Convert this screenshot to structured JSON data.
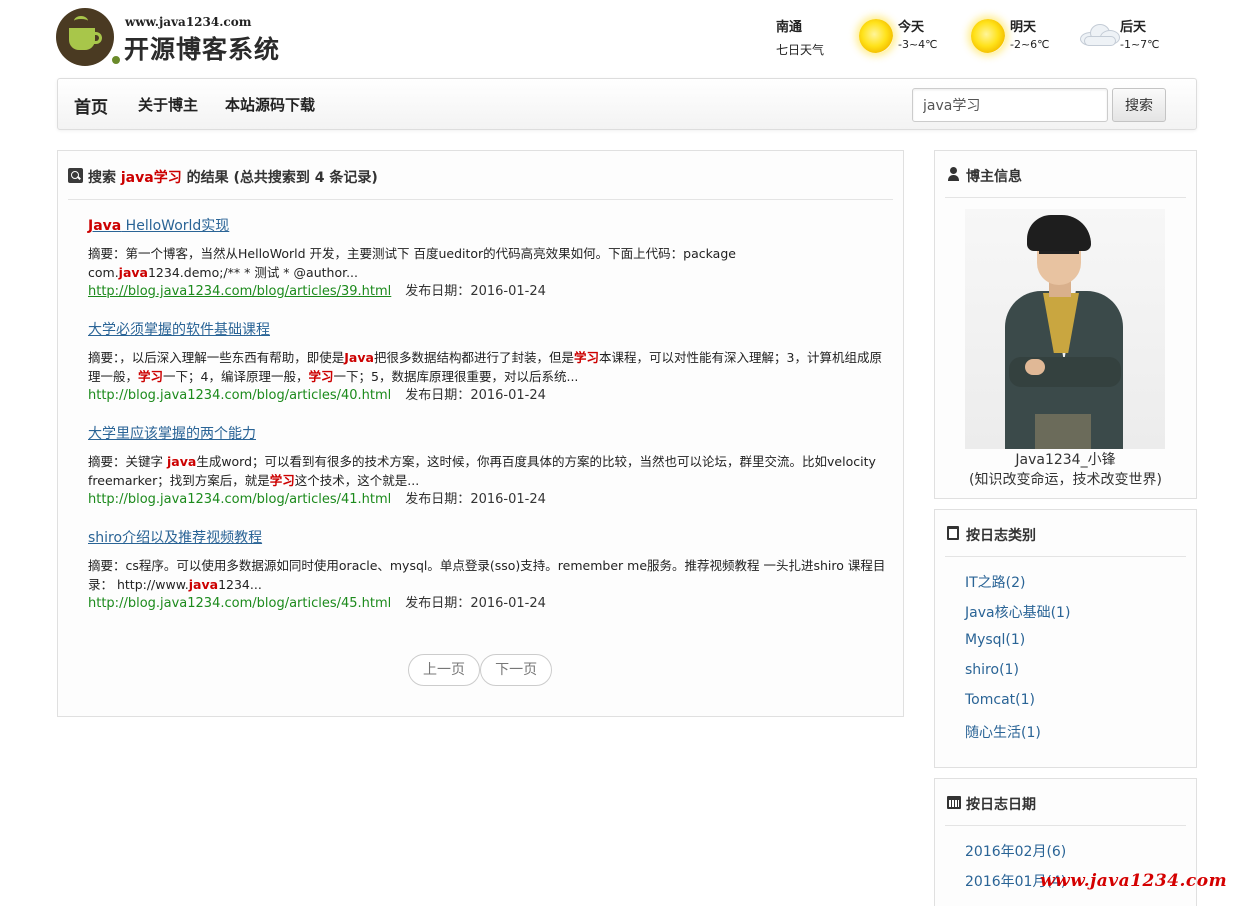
{
  "header": {
    "site_url": "www.java1234.com",
    "site_name": "开源博客系统"
  },
  "weather": {
    "city": "南通",
    "subtitle": "七日天气",
    "days": [
      {
        "label": "今天",
        "temp": "-3~4℃",
        "icon": "sunny-icon"
      },
      {
        "label": "明天",
        "temp": "-2~6℃",
        "icon": "sunny-icon"
      },
      {
        "label": "后天",
        "temp": "-1~7℃",
        "icon": "cloudy-icon"
      }
    ]
  },
  "nav": {
    "home": "首页",
    "about": "关于博主",
    "source": "本站源码下载",
    "search_value": "java学习",
    "search_button": "搜索"
  },
  "search": {
    "prefix": "搜索 ",
    "keyword": "java学习",
    "middle": " 的结果 ",
    "summary": "(总共搜索到 4 条记录)",
    "summary_label": "摘要：",
    "date_label": "发布日期：",
    "results": [
      {
        "title_hl": "Java",
        "title_rest": " HelloWorld实现",
        "summary_parts": [
          "第一个博客，当然从HelloWorld 开发，主要测试下 百度ueditor的代码高亮效果如何。下面上代码：package com.",
          "java",
          "1234.demo;/** * 测试 * @author..."
        ],
        "url": "http://blog.java1234.com/blog/articles/39.html",
        "date": "2016-01-24"
      },
      {
        "title_hl": "",
        "title_rest": "大学必须掌握的软件基础课程",
        "summary_parts": [
          "，以后深入理解一些东西有帮助，即使是",
          "Java",
          "把很多数据结构都进行了封装，但是",
          "学习",
          "本课程，可以对性能有深入理解；3，计算机组成原理一般，",
          "学习",
          "一下；4，编译原理一般，",
          "学习",
          "一下；5，数据库原理很重要，对以后系统..."
        ],
        "url": "http://blog.java1234.com/blog/articles/40.html",
        "date": "2016-01-24"
      },
      {
        "title_hl": "",
        "title_rest": "大学里应该掌握的两个能力",
        "summary_parts": [
          "关键字 ",
          "java",
          "生成word；可以看到有很多的技术方案，这时候，你再百度具体的方案的比较，当然也可以论坛，群里交流。比如velocity freemarker；找到方案后，就是",
          "学习",
          "这个技术，这个就是..."
        ],
        "url": "http://blog.java1234.com/blog/articles/41.html",
        "date": "2016-01-24"
      },
      {
        "title_hl": "",
        "title_rest": "shiro介绍以及推荐视频教程",
        "summary_parts": [
          "cs程序。可以使用多数据源如同时使用oracle、mysql。单点登录(sso)支持。remember me服务。推荐视频教程 一头扎进shiro 课程目录： http://www.",
          "java",
          "1234..."
        ],
        "url": "http://blog.java1234.com/blog/articles/45.html",
        "date": "2016-01-24"
      }
    ],
    "pager": {
      "prev": "上一页",
      "next": "下一页"
    }
  },
  "sidebar": {
    "blogger": {
      "title": "博主信息",
      "name": "Java1234_小锋",
      "motto": "(知识改变命运，技术改变世界)"
    },
    "categories": {
      "title": "按日志类别",
      "items": [
        "IT之路(2)",
        "Java核心基础(1)",
        "Mysql(1)",
        "shiro(1)",
        "Tomcat(1)",
        "随心生活(1)"
      ]
    },
    "dates": {
      "title": "按日志日期",
      "items": [
        "2016年02月(6)",
        "2016年01月(4)"
      ]
    }
  },
  "watermark": "www.java1234.com",
  "colors": {
    "highlight": "#cc0000",
    "link": "#2a6496",
    "url_green": "#1c8a1c"
  }
}
